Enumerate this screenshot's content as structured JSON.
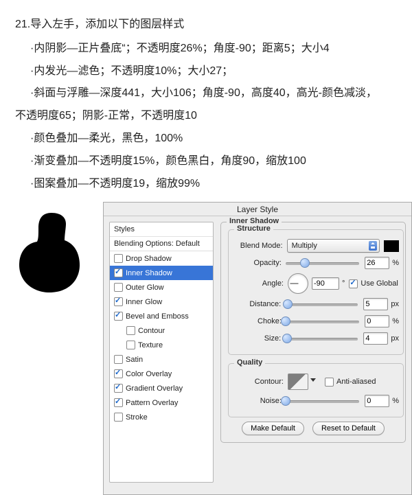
{
  "instructions": {
    "title": "21.导入左手，添加以下的图层样式",
    "lines": [
      "·内阴影—正片叠底“；不透明度26%；角度-90；距离5；大小4",
      "·内发光—滤色；不透明度10%；大小27；",
      "·斜面与浮雕—深度441，大小106；角度-90，高度40，高光-颜色减淡，",
      "不透明度65；阴影-正常，不透明度10",
      "·颜色叠加—柔光，黑色，100%",
      "·渐变叠加—不透明度15%，颜色黑白，角度90，缩放100",
      "·图案叠加—不透明度19，缩放99%"
    ]
  },
  "panel": {
    "title": "Layer Style",
    "styles_header": "Styles",
    "blending_options": "Blending Options: Default",
    "effects": [
      {
        "label": "Drop Shadow",
        "checked": false,
        "selected": false
      },
      {
        "label": "Inner Shadow",
        "checked": true,
        "selected": true
      },
      {
        "label": "Outer Glow",
        "checked": false,
        "selected": false
      },
      {
        "label": "Inner Glow",
        "checked": true,
        "selected": false
      },
      {
        "label": "Bevel and Emboss",
        "checked": true,
        "selected": false
      },
      {
        "label": "Contour",
        "checked": false,
        "selected": false,
        "indent": true
      },
      {
        "label": "Texture",
        "checked": false,
        "selected": false,
        "indent": true
      },
      {
        "label": "Satin",
        "checked": false,
        "selected": false
      },
      {
        "label": "Color Overlay",
        "checked": true,
        "selected": false
      },
      {
        "label": "Gradient Overlay",
        "checked": true,
        "selected": false
      },
      {
        "label": "Pattern Overlay",
        "checked": true,
        "selected": false
      },
      {
        "label": "Stroke",
        "checked": false,
        "selected": false
      }
    ],
    "inner_shadow": {
      "group_label": "Inner Shadow",
      "structure_label": "Structure",
      "blend_mode_label": "Blend Mode:",
      "blend_mode_value": "Multiply",
      "color": "#000000",
      "opacity_label": "Opacity:",
      "opacity_value": "26",
      "opacity_unit": "%",
      "angle_label": "Angle:",
      "angle_value": "-90",
      "angle_unit": "°",
      "use_global_label": "Use Global",
      "use_global_checked": true,
      "distance_label": "Distance:",
      "distance_value": "5",
      "distance_unit": "px",
      "choke_label": "Choke:",
      "choke_value": "0",
      "choke_unit": "%",
      "size_label": "Size:",
      "size_value": "4",
      "size_unit": "px",
      "quality_label": "Quality",
      "contour_label": "Contour:",
      "anti_aliased_label": "Anti-aliased",
      "anti_aliased_checked": false,
      "noise_label": "Noise:",
      "noise_value": "0",
      "noise_unit": "%",
      "make_default": "Make Default",
      "reset_default": "Reset to Default"
    }
  }
}
